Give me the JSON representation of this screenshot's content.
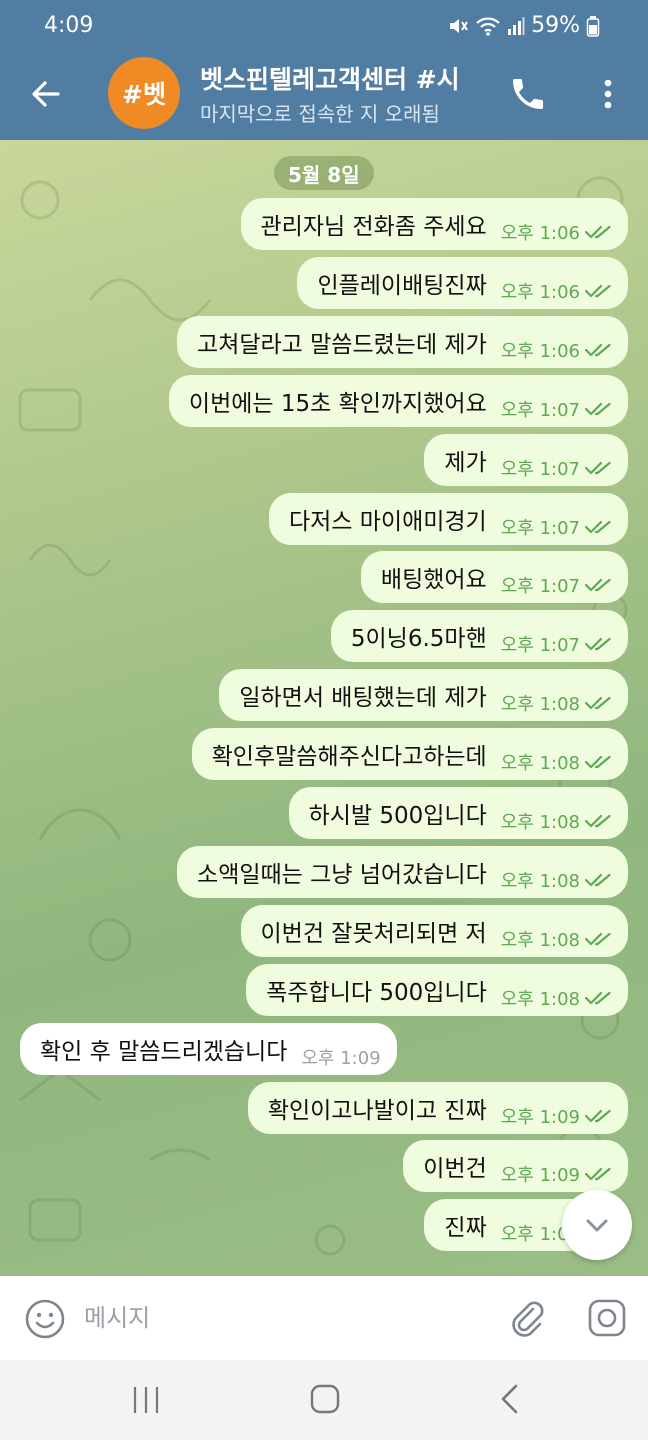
{
  "status_bar": {
    "time": "4:09",
    "battery": "59%"
  },
  "header": {
    "avatar_text": "#벳",
    "title": "벳스핀텔레고객센터 #시",
    "subtitle": "마지막으로 접속한 지 오래됨"
  },
  "chat": {
    "date_label": "5월 8일",
    "messages": [
      {
        "dir": "out",
        "text": "관리자님 전화좀 주세요",
        "time": "오후 1:06",
        "read": true
      },
      {
        "dir": "out",
        "text": "인플레이배팅진짜",
        "time": "오후 1:06",
        "read": true
      },
      {
        "dir": "out",
        "text": "고쳐달라고 말씀드렸는데 제가",
        "time": "오후 1:06",
        "read": true
      },
      {
        "dir": "out",
        "text": "이번에는 15초 확인까지했어요",
        "time": "오후 1:07",
        "read": true
      },
      {
        "dir": "out",
        "text": "제가",
        "time": "오후 1:07",
        "read": true
      },
      {
        "dir": "out",
        "text": "다저스 마이애미경기",
        "time": "오후 1:07",
        "read": true
      },
      {
        "dir": "out",
        "text": "배팅했어요",
        "time": "오후 1:07",
        "read": true
      },
      {
        "dir": "out",
        "text": "5이닝6.5마핸",
        "time": "오후 1:07",
        "read": true
      },
      {
        "dir": "out",
        "text": "일하면서 배팅했는데 제가",
        "time": "오후 1:08",
        "read": true
      },
      {
        "dir": "out",
        "text": "확인후말씀해주신다고하는데",
        "time": "오후 1:08",
        "read": true
      },
      {
        "dir": "out",
        "text": "하시발 500입니다",
        "time": "오후 1:08",
        "read": true
      },
      {
        "dir": "out",
        "text": "소액일때는 그냥 넘어갔습니다",
        "time": "오후 1:08",
        "read": true
      },
      {
        "dir": "out",
        "text": "이번건 잘못처리되면 저",
        "time": "오후 1:08",
        "read": true
      },
      {
        "dir": "out",
        "text": "폭주합니다 500입니다",
        "time": "오후 1:08",
        "read": true
      },
      {
        "dir": "in",
        "text": "확인 후 말씀드리겠습니다",
        "time": "오후 1:09",
        "read": false
      },
      {
        "dir": "out",
        "text": "확인이고나발이고 진짜",
        "time": "오후 1:09",
        "read": true
      },
      {
        "dir": "out",
        "text": "이번건",
        "time": "오후 1:09",
        "read": true
      },
      {
        "dir": "out",
        "text": "진짜",
        "time": "오후 1:09",
        "read": true
      }
    ]
  },
  "input": {
    "placeholder": "메시지"
  },
  "colors": {
    "header_bg": "#517da2",
    "outgoing_bubble": "#effdde",
    "incoming_bubble": "#ffffff",
    "outgoing_time": "#5fa854",
    "avatar_bg": "#f08a24"
  },
  "icons": {
    "back": "arrow-left-icon",
    "call": "phone-icon",
    "menu": "more-vertical-icon",
    "read": "double-check-icon",
    "scroll": "chevron-down-icon",
    "emoji": "smile-icon",
    "attach": "paperclip-icon",
    "camera": "camera-icon"
  }
}
